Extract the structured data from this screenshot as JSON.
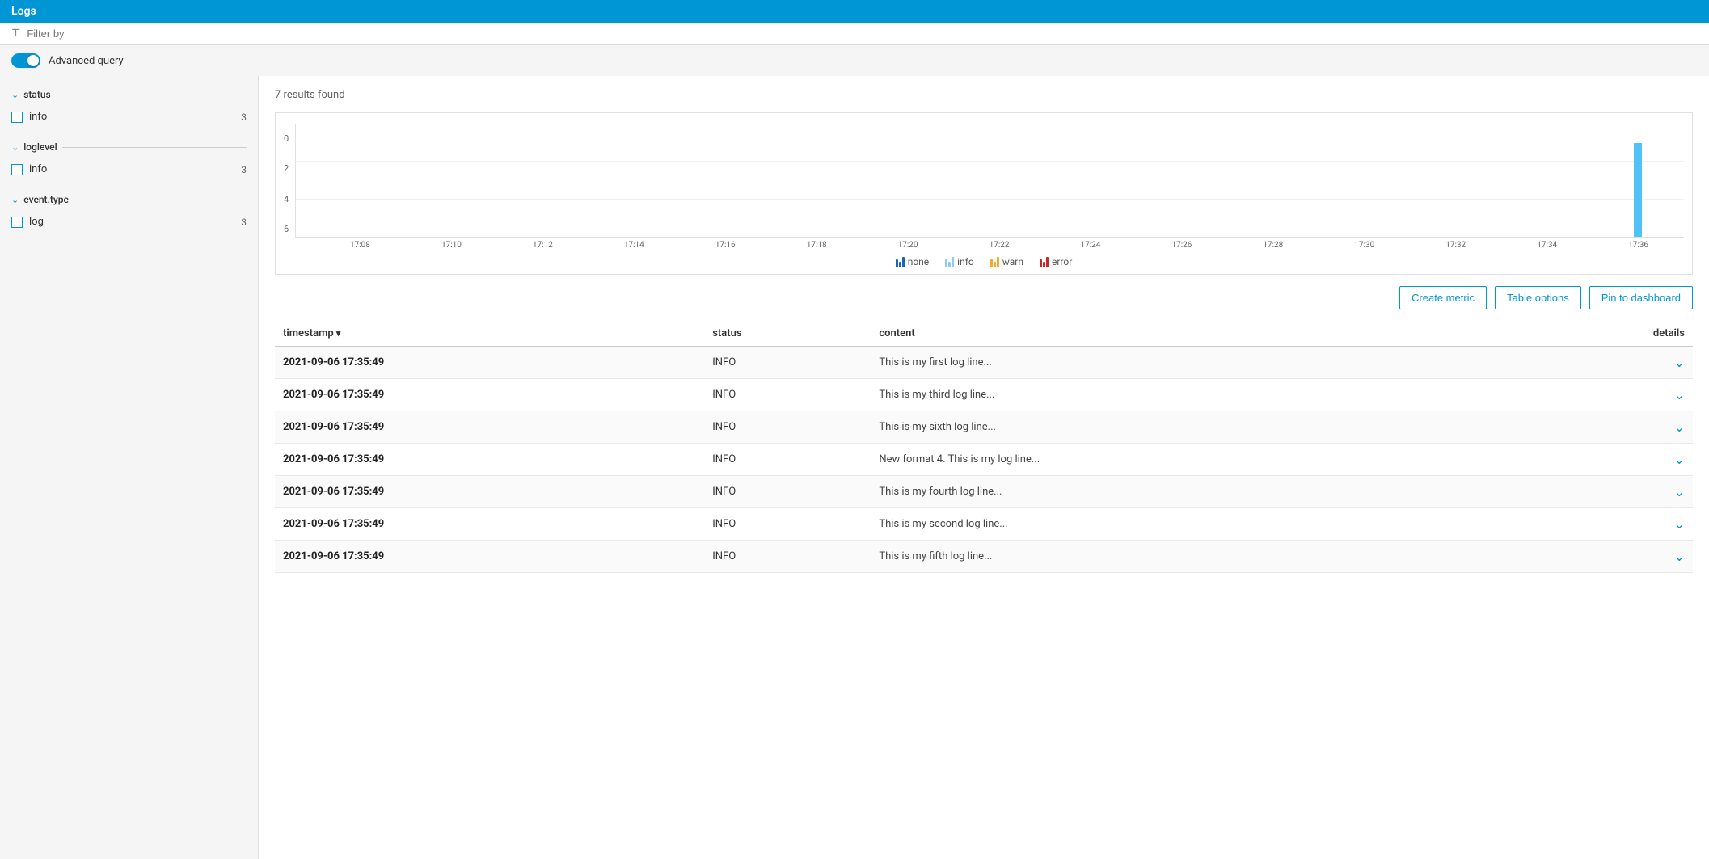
{
  "header": {
    "title": "Logs"
  },
  "filter": {
    "placeholder": "Filter by"
  },
  "advanced_query": {
    "label": "Advanced query",
    "enabled": true
  },
  "sidebar": {
    "groups": [
      {
        "name": "status",
        "items": [
          {
            "label": "info",
            "count": 3
          }
        ]
      },
      {
        "name": "loglevel",
        "items": [
          {
            "label": "info",
            "count": 3
          }
        ]
      },
      {
        "name": "event.type",
        "items": [
          {
            "label": "log",
            "count": 3
          }
        ]
      }
    ]
  },
  "results": {
    "count_label": "7 results found"
  },
  "chart": {
    "y_labels": [
      "0",
      "2",
      "4",
      "6"
    ],
    "x_labels": [
      "17:08",
      "17:10",
      "17:12",
      "17:14",
      "17:16",
      "17:18",
      "17:20",
      "17:22",
      "17:24",
      "17:26",
      "17:28",
      "17:30",
      "17:32",
      "17:34",
      "17:36"
    ],
    "legend": [
      {
        "label": "none",
        "color": "#1565c0"
      },
      {
        "label": "info",
        "color": "#90caf9"
      },
      {
        "label": "warn",
        "color": "#f9a825"
      },
      {
        "label": "error",
        "color": "#c62828"
      }
    ]
  },
  "buttons": {
    "create_metric": "Create metric",
    "table_options": "Table options",
    "pin_to_dashboard": "Pin to dashboard"
  },
  "table": {
    "columns": [
      "timestamp",
      "status",
      "content",
      "details"
    ],
    "sort_column": "timestamp",
    "rows": [
      {
        "timestamp": "2021-09-06 17:35:49",
        "status": "INFO",
        "content": "This is my first log line..."
      },
      {
        "timestamp": "2021-09-06 17:35:49",
        "status": "INFO",
        "content": "This is my third log line..."
      },
      {
        "timestamp": "2021-09-06 17:35:49",
        "status": "INFO",
        "content": "This is my sixth log line..."
      },
      {
        "timestamp": "2021-09-06 17:35:49",
        "status": "INFO",
        "content": "New format 4. This is my log line..."
      },
      {
        "timestamp": "2021-09-06 17:35:49",
        "status": "INFO",
        "content": "This is my fourth log line..."
      },
      {
        "timestamp": "2021-09-06 17:35:49",
        "status": "INFO",
        "content": "This is my second log line..."
      },
      {
        "timestamp": "2021-09-06 17:35:49",
        "status": "INFO",
        "content": "This is my fifth log line..."
      }
    ]
  }
}
